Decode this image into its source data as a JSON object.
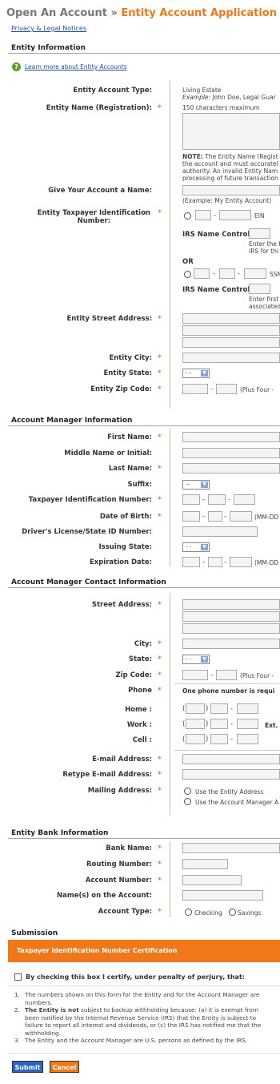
{
  "header": {
    "title_gray": "Open An Account » ",
    "title_orange": "Entity Account Application",
    "privacy_link": "Privacy & Legal Notices"
  },
  "entity_info": {
    "section_title": "Entity Information",
    "learn_more": "Learn more about Entity Accounts",
    "type_label": "Entity Account Type:",
    "type_value": "Living Estate",
    "type_example_prefix": "Example:",
    "type_example": " John Doe, Legal Guar",
    "name_label": "Entity Name (Registration):",
    "name_hint": "150 characters maximum",
    "note_bold": "NOTE:",
    "note_lines": [
      " The Entity Name (Regist",
      "the account and must accuratel",
      "authority. An invalid Entity Nam",
      "processing of future transaction"
    ],
    "give_name_label": "Give Your Account a Name:",
    "give_name_example": "(Example: My Entity Account)",
    "tin_label_1": "Entity Taxpayer Identification",
    "tin_label_2": "Number:",
    "ein": "EIN",
    "dash": "-",
    "irs_control": "IRS Name Control:",
    "irs_note_1a": "Enter the f",
    "irs_note_1b": "IRS for thi",
    "or": "OR",
    "ssn": "SSN",
    "irs_note_2a": "Enter first",
    "irs_note_2b": "associated",
    "street_label": "Entity Street Address:",
    "city_label": "Entity City:",
    "state_label": "Entity State:",
    "state_value": "- -",
    "zip_label": "Entity Zip Code:",
    "zip_hint": "(Plus Four -"
  },
  "manager_info": {
    "section_title": "Account Manager Information",
    "first_name": "First Name:",
    "middle_name": "Middle Name or Initial:",
    "last_name": "Last Name:",
    "suffix": "Suffix:",
    "suffix_value": "--",
    "tin": "Taxpayer Identification Number:",
    "dob": "Date of Birth:",
    "dob_hint": "(MM-DD",
    "license": "Driver's License/State ID Number:",
    "issuing_state": "Issuing State:",
    "issuing_value": "- -",
    "expiration": "Expiration Date:",
    "exp_hint": "(MM-DD"
  },
  "contact_info": {
    "section_title": "Account Manager Contact Information",
    "street": "Street Address:",
    "city": "City:",
    "state": "State:",
    "state_value": "- -",
    "zip": "Zip Code:",
    "zip_hint": "(Plus Four -",
    "phone": "Phone",
    "phone_note": "One phone number is requi",
    "home": "Home :",
    "work": "Work :",
    "cell": "Cell :",
    "ext": "Ext.",
    "email": "E-mail Address:",
    "retype_email": "Retype E-mail Address:",
    "mailing": "Mailing Address:",
    "mailing_opt1": "Use the Entity Address",
    "mailing_opt2": "Use the Account Manager A"
  },
  "bank_info": {
    "section_title": "Entity Bank Information",
    "bank_name": "Bank Name:",
    "routing": "Routing Number:",
    "account_number": "Account Number:",
    "names": "Name(s) on the Account:",
    "account_type": "Account Type:",
    "checking": "Checking",
    "savings": "Savings"
  },
  "submission": {
    "section_title": "Submission",
    "cert_title": "Taxpayer Identification Number Certification",
    "certify": "By checking this box I certify, under penalty of perjury, that:",
    "item1_lines": [
      "The numbers shown on this form for the Entity and for the Account Manager are",
      "numbers."
    ],
    "item2_bold": "The Entity is not",
    "item2_lines": [
      " subject to backup withholding because: (a) it is exempt from",
      "been notified by the Internal Revenue Service (IRS) that the Entity is subject to",
      "failure to report all interest and dividends, or (c) the IRS has notified me that the",
      "withholding."
    ],
    "item3": "The Entity and the Account Manager are U.S. persons as defined by the IRS.",
    "submit": "Submit",
    "cancel": "Cancel"
  },
  "colors": {
    "accent": "#f07818",
    "link": "#1f4e9c",
    "submit": "#2a63c2"
  }
}
